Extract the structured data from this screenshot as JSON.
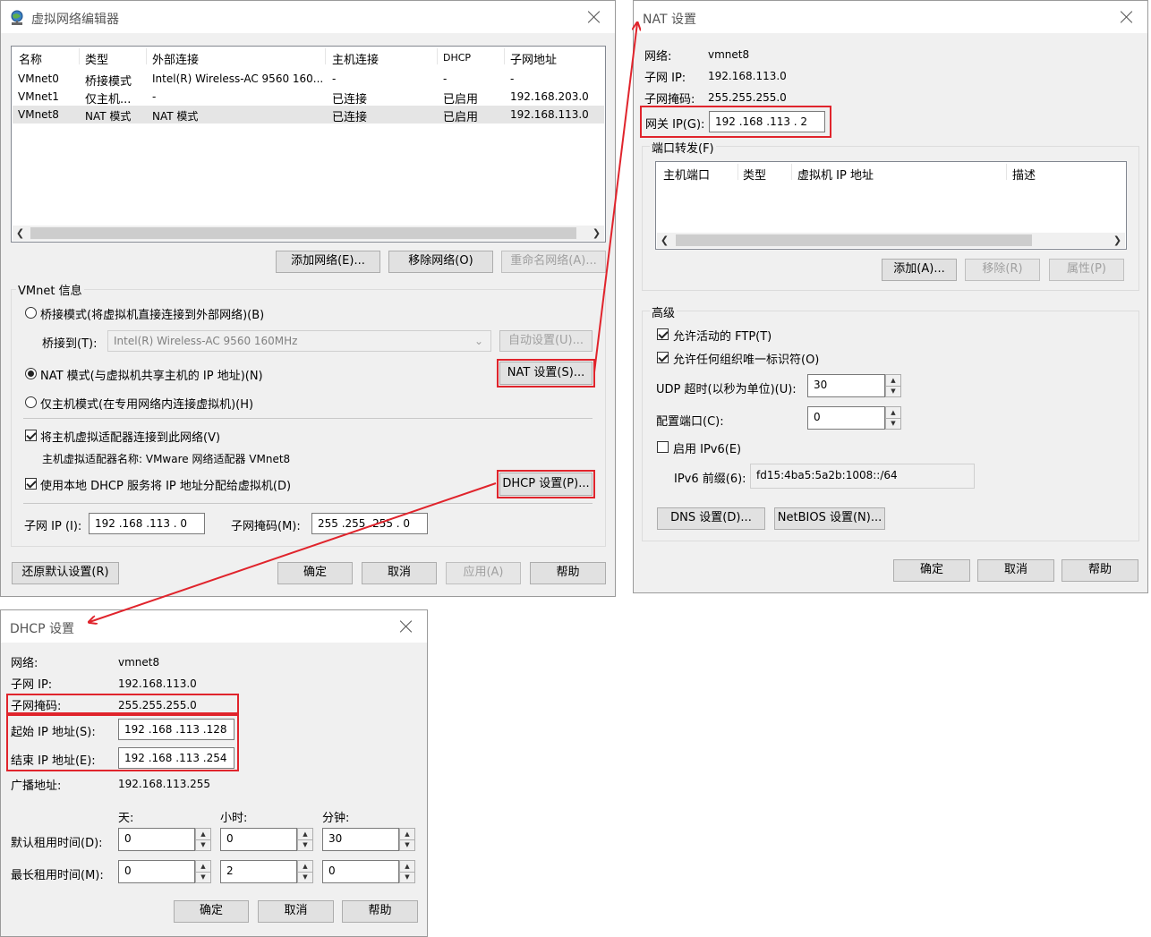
{
  "editor": {
    "title": "虚拟网络编辑器",
    "columns": [
      "名称",
      "类型",
      "外部连接",
      "主机连接",
      "DHCP",
      "子网地址"
    ],
    "rows": [
      [
        "VMnet0",
        "桥接模式",
        "Intel(R) Wireless-AC 9560 160...",
        "-",
        "-",
        "-"
      ],
      [
        "VMnet1",
        "仅主机...",
        "-",
        "已连接",
        "已启用",
        "192.168.203.0"
      ],
      [
        "VMnet8",
        "NAT 模式",
        "NAT 模式",
        "已连接",
        "已启用",
        "192.168.113.0"
      ]
    ],
    "add_network": "添加网络(E)...",
    "remove_network": "移除网络(O)",
    "rename_network": "重命名网络(A)...",
    "vmnet_info": "VMnet 信息",
    "bridged_mode": "桥接模式(将虚拟机直接连接到外部网络)(B)",
    "bridged_to_label": "桥接到(T):",
    "bridged_to_value": "Intel(R) Wireless-AC 9560 160MHz",
    "auto_settings": "自动设置(U)...",
    "nat_mode": "NAT 模式(与虚拟机共享主机的 IP 地址)(N)",
    "nat_settings": "NAT 设置(S)...",
    "host_only_mode": "仅主机模式(在专用网络内连接虚拟机)(H)",
    "connect_adapter": "将主机虚拟适配器连接到此网络(V)",
    "adapter_name": "主机虚拟适配器名称: VMware 网络适配器 VMnet8",
    "use_dhcp": "使用本地 DHCP 服务将 IP 地址分配给虚拟机(D)",
    "dhcp_settings": "DHCP 设置(P)...",
    "subnet_ip_label": "子网 IP (I):",
    "subnet_ip": "192 .168 .113 .  0",
    "subnet_mask_label": "子网掩码(M):",
    "subnet_mask": "255 .255 .255 .  0",
    "restore_defaults": "还原默认设置(R)",
    "ok": "确定",
    "cancel": "取消",
    "apply": "应用(A)",
    "help": "帮助"
  },
  "nat": {
    "title": "NAT 设置",
    "network_label": "网络:",
    "network": "vmnet8",
    "subnet_ip_label": "子网 IP:",
    "subnet_ip": "192.168.113.0",
    "subnet_mask_label": "子网掩码:",
    "subnet_mask": "255.255.255.0",
    "gateway_label": "网关 IP(G):",
    "gateway": "192 .168 .113 .  2",
    "port_forwarding": "端口转发(F)",
    "pf_columns": [
      "主机端口",
      "类型",
      "虚拟机 IP 地址",
      "描述"
    ],
    "add": "添加(A)...",
    "remove": "移除(R)",
    "properties": "属性(P)",
    "advanced": "高级",
    "allow_ftp": "允许活动的 FTP(T)",
    "allow_any_oui": "允许任何组织唯一标识符(O)",
    "udp_timeout_label": "UDP 超时(以秒为单位)(U):",
    "udp_timeout": "30",
    "config_port_label": "配置端口(C):",
    "config_port": "0",
    "enable_ipv6": "启用 IPv6(E)",
    "ipv6_prefix_label": "IPv6 前缀(6):",
    "ipv6_prefix": "fd15:4ba5:5a2b:1008::/64",
    "dns_settings": "DNS 设置(D)...",
    "netbios_settings": "NetBIOS 设置(N)...",
    "ok": "确定",
    "cancel": "取消",
    "help": "帮助"
  },
  "dhcp": {
    "title": "DHCP 设置",
    "network_label": "网络:",
    "network": "vmnet8",
    "subnet_ip_label": "子网 IP:",
    "subnet_ip": "192.168.113.0",
    "subnet_mask_label": "子网掩码:",
    "subnet_mask": "255.255.255.0",
    "start_ip_label": "起始 IP 地址(S):",
    "start_ip": "192 .168 .113 .128",
    "end_ip_label": "结束 IP 地址(E):",
    "end_ip": "192 .168 .113 .254",
    "broadcast_label": "广播地址:",
    "broadcast": "192.168.113.255",
    "days": "天:",
    "hours": "小时:",
    "minutes": "分钟:",
    "default_lease_label": "默认租用时间(D):",
    "default_lease": [
      "0",
      "0",
      "30"
    ],
    "max_lease_label": "最长租用时间(M):",
    "max_lease": [
      "0",
      "2",
      "0"
    ],
    "ok": "确定",
    "cancel": "取消",
    "help": "帮助"
  },
  "colors": {
    "highlight": "#e0242c",
    "window_bg": "#f0f0f0"
  }
}
